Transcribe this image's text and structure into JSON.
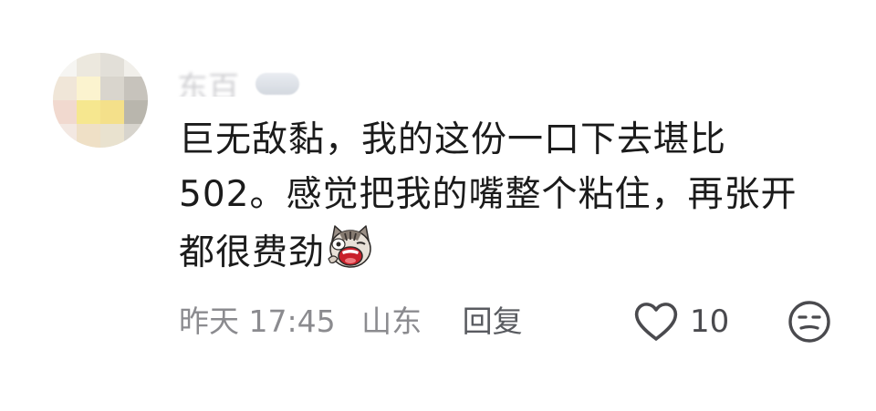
{
  "comment": {
    "username": "东百",
    "text_lines": [
      "巨无敌黏，我的这份一口下去堪比",
      "502。感觉把我的嘴整个粘住，再张开",
      "都很费劲"
    ],
    "emoji_icon": "screaming-cat-emoji",
    "time": "昨天 17:45",
    "location": "山东",
    "reply_label": "回复",
    "like_count": "10",
    "icons": {
      "like": "heart-outline-icon",
      "dislike": "unhappy-face-icon"
    }
  }
}
